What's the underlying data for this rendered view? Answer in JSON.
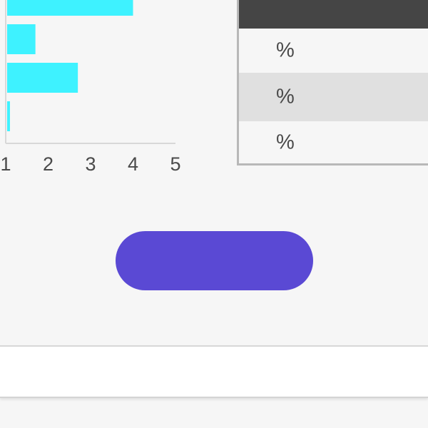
{
  "chart_data": {
    "type": "bar",
    "orientation": "horizontal",
    "values": [
      4,
      1.7,
      2.7,
      1.1
    ],
    "xlim": [
      1,
      5
    ],
    "x_ticks": [
      "1",
      "2",
      "3",
      "4",
      "5"
    ],
    "bar_color": "#3ef2ff",
    "grid": false
  },
  "table": {
    "header_color": "#454545",
    "rows": [
      {
        "value": "%"
      },
      {
        "value": "%"
      },
      {
        "value": "%"
      }
    ]
  },
  "primary_button": {
    "label": "",
    "color": "#5a49d4"
  }
}
